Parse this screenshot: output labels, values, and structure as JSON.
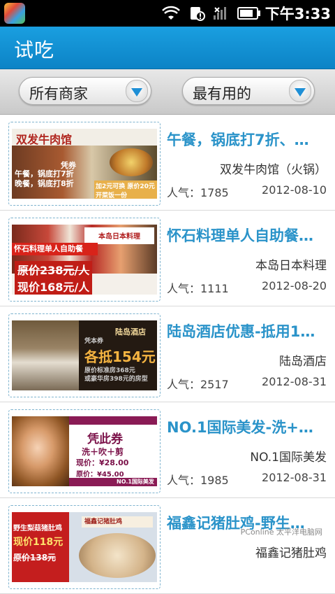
{
  "status_bar": {
    "time": "下午3:33",
    "battery_level": 0.85,
    "icons": [
      "app-icon",
      "wifi-icon",
      "notification-icon",
      "signal-icon",
      "battery-icon"
    ]
  },
  "header": {
    "title": "试吃"
  },
  "filters": {
    "merchant": {
      "selected": "所有商家"
    },
    "sort": {
      "selected": "最有用的"
    }
  },
  "colors": {
    "title_bar": "#1a9fe0",
    "item_title": "#2a93c9",
    "accent_arrow": "#1e8fd6"
  },
  "items": [
    {
      "title": "午餐，锅底打7折、…",
      "merchant": "双发牛肉馆（火锅）",
      "popularity": "人气：1785",
      "date": "2012-08-10",
      "thumb": {
        "sign": "双发牛肉馆",
        "voucher": "凭券",
        "line1": "午餐，锅底打7折",
        "line2": "晚餐，锅底打8折",
        "note": "加2元可换 原价20元开菜饭一份"
      }
    },
    {
      "title": "怀石料理单人自助餐…",
      "merchant": "本岛日本料理",
      "popularity": "人气：1111",
      "date": "2012-08-20",
      "thumb": {
        "logo": "本岛日本料理",
        "banner": "怀石料理单人自助餐",
        "orig": "原价238元/人",
        "now": "现价168元/人"
      }
    },
    {
      "title": "陆岛酒店优惠-抵用1…",
      "merchant": "陆岛酒店",
      "popularity": "人气：2517",
      "date": "2012-08-31",
      "thumb": {
        "hotel": "陆岛酒店",
        "label": "凭本券",
        "deduct": "各抵154元",
        "fine1": "原价标准房368元",
        "fine2": "或豪华房398元的房型"
      }
    },
    {
      "title": "NO.1国际美发-洗+…",
      "merchant": "NO.1国际美发",
      "popularity": "人气：1985",
      "date": "2012-08-31",
      "thumb": {
        "coupon": "凭此券",
        "services": "洗＋吹＋剪",
        "price_now": "现价：¥28.00",
        "price_orig": "原价：¥45.00",
        "brand": "NO.1国际美发"
      }
    },
    {
      "title": "福鑫记猪肚鸡-野生…",
      "merchant": "福鑫记猪肚鸡",
      "popularity": "",
      "date": "",
      "thumb": {
        "name": "野生梨菇猪肚鸡",
        "now": "现价118元",
        "orig": "原价138元",
        "logo": "福鑫记猪肚鸡"
      }
    }
  ],
  "watermark": "PConline 太平洋电脑网"
}
